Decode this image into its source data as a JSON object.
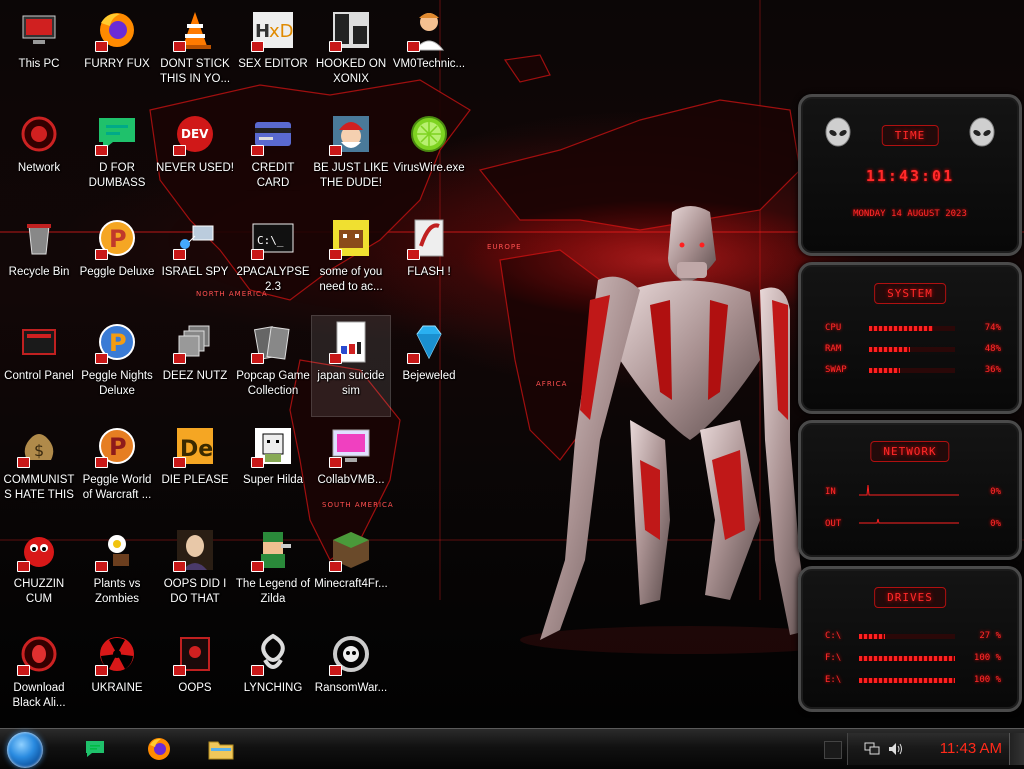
{
  "desktop": {
    "icons": [
      {
        "label": "This PC",
        "icon": "computer-icon",
        "shortcut": false
      },
      {
        "label": "Network",
        "icon": "network-icon",
        "shortcut": false
      },
      {
        "label": "Recycle Bin",
        "icon": "recycle-bin-icon",
        "shortcut": false
      },
      {
        "label": "Control Panel",
        "icon": "control-panel-icon",
        "shortcut": false
      },
      {
        "label": "COMMUNISTS HATE THIS G...",
        "icon": "money-bag-icon",
        "shortcut": true
      },
      {
        "label": "CHUZZIN CUM",
        "icon": "chuzzle-icon",
        "shortcut": true
      },
      {
        "label": "Download Black Ali...",
        "icon": "alienware-icon",
        "shortcut": true
      },
      {
        "label": "FURRY FUX",
        "icon": "firefox-icon",
        "shortcut": true
      },
      {
        "label": "D FOR DUMBASS",
        "icon": "chat-bubble-icon",
        "shortcut": true
      },
      {
        "label": "Peggle Deluxe",
        "icon": "peggle-icon",
        "shortcut": true
      },
      {
        "label": "Peggle Nights Deluxe",
        "icon": "peggle-nights-icon",
        "shortcut": true
      },
      {
        "label": "Peggle World of Warcraft ...",
        "icon": "peggle-wow-icon",
        "shortcut": true
      },
      {
        "label": "Plants vs Zombies",
        "icon": "plants-vs-zombies-icon",
        "shortcut": true
      },
      {
        "label": "UKRAINE",
        "icon": "radiation-icon",
        "shortcut": true
      },
      {
        "label": "DONT STICK THIS IN YO...",
        "icon": "traffic-cone-icon",
        "shortcut": true
      },
      {
        "label": "NEVER USED!",
        "icon": "dev-cpp-icon",
        "shortcut": true
      },
      {
        "label": "ISRAEL SPY",
        "icon": "network-spy-icon",
        "shortcut": true
      },
      {
        "label": "DEEZ NUTZ",
        "icon": "stacked-windows-icon",
        "shortcut": true
      },
      {
        "label": "DIE PLEASE",
        "icon": "de-icon",
        "shortcut": true
      },
      {
        "label": "OOPS DID I DO THAT",
        "icon": "portrait-icon",
        "shortcut": true
      },
      {
        "label": "OOPS",
        "icon": "dark-app-icon",
        "shortcut": true
      },
      {
        "label": "SEX EDITOR",
        "icon": "hex-editor-icon",
        "shortcut": true
      },
      {
        "label": "CREDIT CARD CHECKER",
        "icon": "credit-card-icon",
        "shortcut": true
      },
      {
        "label": "2PACALYPSE 2.3",
        "icon": "terminal-icon",
        "shortcut": true
      },
      {
        "label": "Popcap Game Collection",
        "icon": "popcap-collection-icon",
        "shortcut": true
      },
      {
        "label": "Super Hilda",
        "icon": "pixel-dog-icon",
        "shortcut": true
      },
      {
        "label": "The Legend of Zilda",
        "icon": "zelda-sprite-icon",
        "shortcut": true
      },
      {
        "label": "LYNCHING",
        "icon": "knot-icon",
        "shortcut": true
      },
      {
        "label": "HOOKED ON XONIX",
        "icon": "xonix-icon",
        "shortcut": true
      },
      {
        "label": "BE JUST LIKE THE DUDE!",
        "icon": "santa-icon",
        "shortcut": true
      },
      {
        "label": "some of you need to ac...",
        "icon": "pixel-beaver-icon",
        "shortcut": true
      },
      {
        "label": "japan suicide sim",
        "icon": "document-icon",
        "shortcut": true
      },
      {
        "label": "CollabVMB...",
        "icon": "monitor-icon",
        "shortcut": true
      },
      {
        "label": "Minecraft4Fr...",
        "icon": "grass-block-icon",
        "shortcut": true
      },
      {
        "label": "RansomWar...",
        "icon": "skull-ring-icon",
        "shortcut": true
      },
      {
        "label": "VM0Technic...",
        "icon": "doctor-icon",
        "shortcut": true
      },
      {
        "label": "VirusWire.exe",
        "icon": "lime-icon",
        "shortcut": false
      },
      {
        "label": "FLASH !",
        "icon": "flash-icon",
        "shortcut": true
      },
      {
        "label": "Bejeweled",
        "icon": "gem-icon",
        "shortcut": true
      }
    ],
    "selected_index": 31
  },
  "wallpaper": {
    "continent_labels": [
      "NORTH AMERICA",
      "EUROPE",
      "AFRICA",
      "SOUTH AMERICA"
    ]
  },
  "gadgets": {
    "time": {
      "title": "TIME",
      "clock": "11:43:01",
      "date": "MONDAY 14 AUGUST 2023"
    },
    "system": {
      "title": "SYSTEM",
      "rows": [
        {
          "label": "CPU",
          "value_text": "74%",
          "value": 0.74
        },
        {
          "label": "RAM",
          "value_text": "48%",
          "value": 0.48
        },
        {
          "label": "SWAP",
          "value_text": "36%",
          "value": 0.36
        }
      ]
    },
    "network": {
      "title": "NETWORK",
      "rows": [
        {
          "label": "IN",
          "value_text": "0%"
        },
        {
          "label": "OUT",
          "value_text": "0%"
        }
      ]
    },
    "drives": {
      "title": "DRIVES",
      "rows": [
        {
          "label": "C:\\",
          "value_text": "27 %",
          "value": 0.27
        },
        {
          "label": "F:\\",
          "value_text": "100 %",
          "value": 1.0
        },
        {
          "label": "E:\\",
          "value_text": "100 %",
          "value": 1.0
        }
      ]
    }
  },
  "taskbar": {
    "pinned": [
      {
        "name": "chat-app",
        "icon": "chat-bubble-icon"
      },
      {
        "name": "firefox",
        "icon": "firefox-icon"
      },
      {
        "name": "file-explorer",
        "icon": "folder-icon"
      }
    ],
    "clock": "11:43 AM"
  },
  "colors": {
    "accent": "#ff2a1a",
    "shortcut_badge": "#c81818"
  }
}
